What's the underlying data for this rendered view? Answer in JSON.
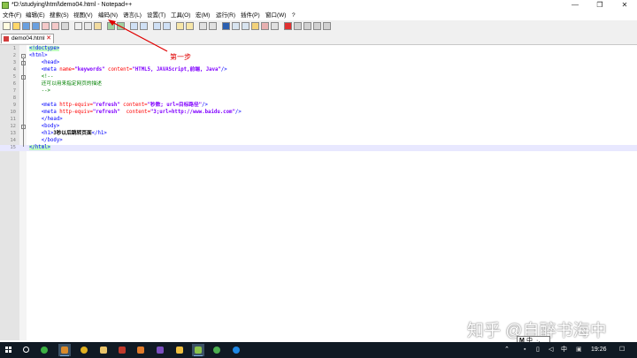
{
  "window": {
    "title": "*D:\\studying\\html\\demo04.html - Notepad++",
    "minimize_glyph": "—",
    "maximize_glyph": "❐",
    "close_glyph": "✕"
  },
  "menu": [
    "文件(F)",
    "编辑(E)",
    "搜索(S)",
    "视图(V)",
    "编码(N)",
    "语言(L)",
    "设置(T)",
    "工具(O)",
    "宏(M)",
    "运行(R)",
    "插件(P)",
    "窗口(W)",
    "?"
  ],
  "tab": {
    "label": "demo04.html",
    "close_glyph": "✕"
  },
  "editor": {
    "line_numbers": [
      "1",
      "2",
      "3",
      "4",
      "5",
      "6",
      "7",
      "8",
      "9",
      "10",
      "11",
      "12",
      "13",
      "14",
      "15"
    ],
    "lines": [
      {
        "segments": [
          {
            "t": "<!doctype>",
            "c": "tag hl"
          }
        ]
      },
      {
        "segments": [
          {
            "t": "<html>",
            "c": "tag"
          }
        ]
      },
      {
        "segments": [
          {
            "t": "    ",
            "c": ""
          },
          {
            "t": "<head>",
            "c": "tag"
          }
        ]
      },
      {
        "segments": [
          {
            "t": "    ",
            "c": ""
          },
          {
            "t": "<meta",
            "c": "tag"
          },
          {
            "t": " name=",
            "c": "attr"
          },
          {
            "t": "\"keywords\"",
            "c": "val"
          },
          {
            "t": " content=",
            "c": "attr"
          },
          {
            "t": "\"HTML5, JAVAScript,前端, Java\"",
            "c": "val"
          },
          {
            "t": "/>",
            "c": "tag"
          }
        ]
      },
      {
        "segments": [
          {
            "t": "    ",
            "c": ""
          },
          {
            "t": "<!--",
            "c": "cmt"
          }
        ]
      },
      {
        "segments": [
          {
            "t": "    ",
            "c": ""
          },
          {
            "t": "还可以用来指定网页的描述",
            "c": "cmt"
          }
        ]
      },
      {
        "segments": [
          {
            "t": "    ",
            "c": ""
          },
          {
            "t": "-->",
            "c": "cmt"
          }
        ]
      },
      {
        "segments": []
      },
      {
        "segments": [
          {
            "t": "    ",
            "c": ""
          },
          {
            "t": "<meta",
            "c": "tag"
          },
          {
            "t": " http-equiv=",
            "c": "attr"
          },
          {
            "t": "\"refresh\"",
            "c": "val"
          },
          {
            "t": " content=",
            "c": "attr"
          },
          {
            "t": "\"秒数; url=目标路径\"",
            "c": "val"
          },
          {
            "t": "/>",
            "c": "tag"
          }
        ]
      },
      {
        "segments": [
          {
            "t": "    ",
            "c": ""
          },
          {
            "t": "<meta",
            "c": "tag"
          },
          {
            "t": " http-equiv=",
            "c": "attr"
          },
          {
            "t": "\"refresh\"",
            "c": "val"
          },
          {
            "t": "  content=",
            "c": "attr"
          },
          {
            "t": "\"3;url=http://www.baidu.com\"",
            "c": "val"
          },
          {
            "t": "/>",
            "c": "tag"
          }
        ]
      },
      {
        "segments": [
          {
            "t": "    ",
            "c": ""
          },
          {
            "t": "</head>",
            "c": "tag"
          }
        ]
      },
      {
        "segments": [
          {
            "t": "    ",
            "c": ""
          },
          {
            "t": "<body>",
            "c": "tag"
          }
        ]
      },
      {
        "segments": [
          {
            "t": "    ",
            "c": ""
          },
          {
            "t": "<h1>",
            "c": "tag"
          },
          {
            "t": "3秒以后跳转页面",
            "c": "txt"
          },
          {
            "t": "</h1>",
            "c": "tag"
          }
        ]
      },
      {
        "segments": [
          {
            "t": "    ",
            "c": ""
          },
          {
            "t": "</body>",
            "c": "tag"
          }
        ]
      },
      {
        "segments": [
          {
            "t": "</html>",
            "c": "tag hl"
          }
        ]
      }
    ]
  },
  "annotation": {
    "text": "第一步",
    "color": "#e00000"
  },
  "watermark": "知乎 @自醉书海中",
  "ime": {
    "label": "中"
  },
  "taskbar": {
    "tray": {
      "lang": "中",
      "time": "19:26"
    }
  },
  "colors": {
    "taskbar": "#101a24",
    "gutter": "#e4e4e4",
    "active_line": "#e8e8ff"
  }
}
